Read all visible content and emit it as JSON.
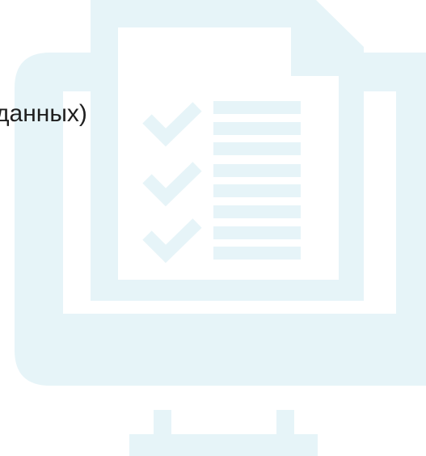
{
  "caption": {
    "text": "данных)"
  },
  "illustration": {
    "icon": "monitor-checklist-icon",
    "color": "#e6f4f8"
  }
}
